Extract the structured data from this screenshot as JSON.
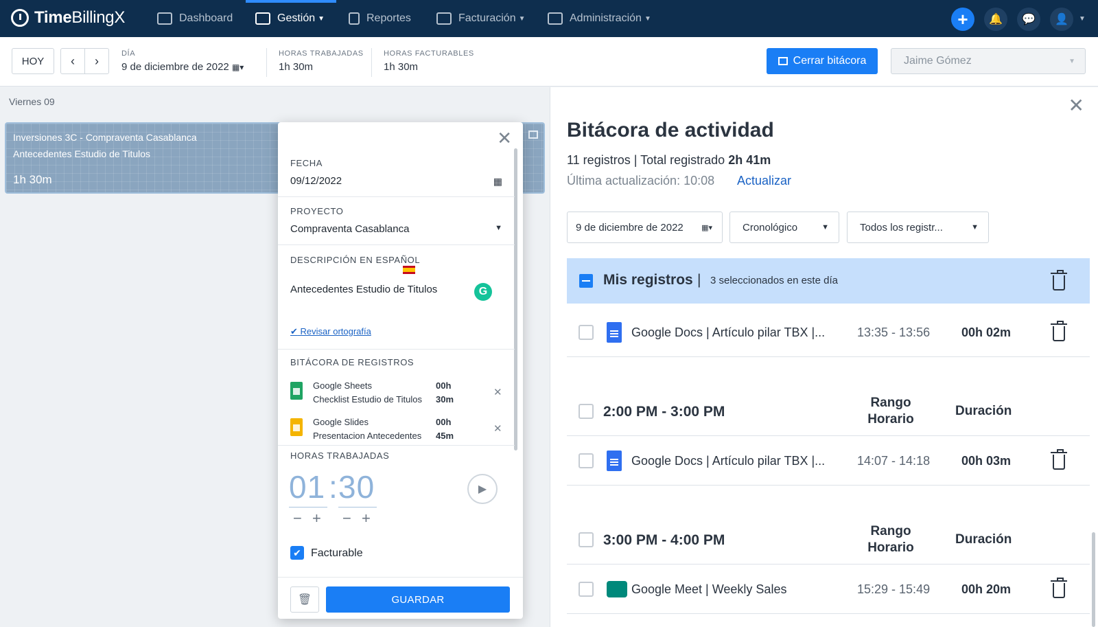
{
  "brand": {
    "bold": "Time",
    "light": "BillingX"
  },
  "nav": {
    "dashboard": "Dashboard",
    "gestion": "Gestión",
    "reportes": "Reportes",
    "facturacion": "Facturación",
    "administracion": "Administración"
  },
  "icons": {
    "add": "plus-icon",
    "notifications": "bell-icon",
    "chat": "chat-icon",
    "user": "user-icon"
  },
  "toolbar": {
    "today": "HOY",
    "prev": "‹",
    "next": "›",
    "day_label": "DÍA",
    "day_value": "9 de diciembre de 2022",
    "worked_label": "HORAS TRABAJADAS",
    "worked_value": "1h 30m",
    "billable_label": "HORAS FACTURABLES",
    "billable_value": "1h 30m",
    "close_log": "Cerrar bitácora",
    "user": "Jaime Gómez"
  },
  "calendar": {
    "day_label": "Viernes 09",
    "event": {
      "title": "Inversiones 3C - Compraventa Casablanca",
      "description": "Antecedentes Estudio de Titulos",
      "duration": "1h 30m"
    }
  },
  "editor": {
    "date_label": "FECHA",
    "date_value": "09/12/2022",
    "project_label": "PROYECTO",
    "project_value": "Compraventa Casablanca",
    "desc_label": "DESCRIPCIÓN EN ESPAÑOL",
    "desc_value": "Antecedentes Estudio de Titulos",
    "grammar_badge": "G",
    "spellcheck": "Revisar ortografía",
    "log_label": "BITÁCORA DE REGISTROS",
    "log_items": [
      {
        "app": "Google Sheets",
        "doc": "Checklist Estudio de Titulos",
        "d1": "00h",
        "d2": "30m",
        "color": "#1fa463"
      },
      {
        "app": "Google Slides",
        "doc": "Presentacion Antecedentes",
        "d1": "00h",
        "d2": "45m",
        "color": "#f4b400"
      }
    ],
    "hours_label": "HORAS TRABAJADAS",
    "hours": "01",
    "colon": ":",
    "minutes": "30",
    "minus": "−",
    "plus": "+",
    "billable_label": "Facturable",
    "save": "GUARDAR"
  },
  "activity": {
    "title": "Bitácora de actividad",
    "count": "11 registros",
    "sep": "|",
    "total_label": "Total registrado",
    "total_value": "2h 41m",
    "updated": "Última actualización: 10:08",
    "refresh": "Actualizar",
    "filter_date": "9 de diciembre de 2022",
    "filter_order": "Cronológico",
    "filter_scope": "Todos los registr...",
    "mine_label": "Mis registros",
    "mine_selected": "3 seleccionados en este día",
    "rows": [
      {
        "text": "Google Docs | Artículo pilar TBX |...",
        "range": "13:35 - 13:56",
        "duration": "00h 02m"
      },
      {
        "text": "Google Docs | Artículo pilar TBX |...",
        "range": "14:07 - 14:18",
        "duration": "00h 03m"
      },
      {
        "text": "Google Meet | Weekly Sales",
        "range": "15:29 - 15:49",
        "duration": "00h 20m"
      }
    ],
    "groups": [
      {
        "title": "2:00 PM - 3:00 PM",
        "range_l1": "Rango",
        "range_l2": "Horario",
        "duration": "Duración"
      },
      {
        "title": "3:00 PM - 4:00 PM",
        "range_l1": "Rango",
        "range_l2": "Horario",
        "duration": "Duración"
      }
    ]
  },
  "colors": {
    "nav_bg": "#0e2e4e",
    "accent": "#1a7ef5",
    "selected_band": "#c6dffc"
  }
}
